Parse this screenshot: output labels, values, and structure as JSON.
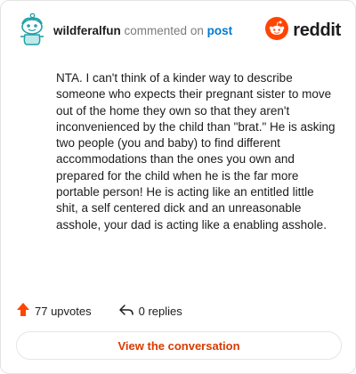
{
  "header": {
    "username": "wildferalfun",
    "commented_on_text": "commented on",
    "post_link": "post",
    "brand_name": "reddit"
  },
  "comment": {
    "text": "NTA. I can't think of a kinder way to describe someone who expects their pregnant sister to move out of the home they own so that they aren't inconvenienced by the child than \"brat.\" He is asking two people (you and baby) to find different accommodations than the ones you own and prepared for the child when he is the far more portable person! He is acting like an entitled little shit, a self centered dick and an unreasonable asshole, your dad is acting like a enabling asshole."
  },
  "actions": {
    "upvotes": "77 upvotes",
    "replies": "0 replies"
  },
  "cta": {
    "label": "View the conversation"
  },
  "colors": {
    "brand_orange": "#ff4500",
    "link_blue": "#0079d3",
    "cta_text": "#d93a00",
    "avatar_teal": "#24a0a8"
  },
  "icons": {
    "avatar": "snoo-avatar-icon",
    "brand": "reddit-logo-icon",
    "upvote": "upvote-arrow-icon",
    "reply": "reply-arrow-icon"
  }
}
